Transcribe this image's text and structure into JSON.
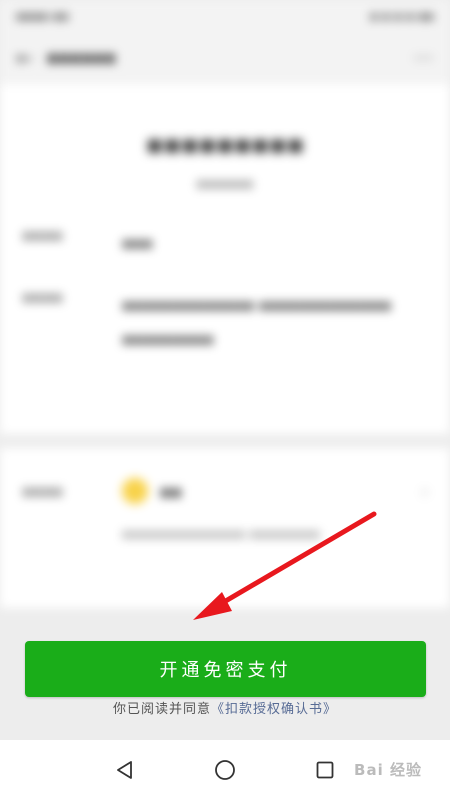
{
  "button": {
    "label": "开通免密支付",
    "color": "#1aad19"
  },
  "agreement": {
    "prefix": "你已阅读并同意",
    "link": "《扣款授权确认书》"
  },
  "system_nav": {
    "back": "back-triangle-icon",
    "home": "home-circle-icon",
    "recent": "recent-square-icon"
  },
  "annotation": {
    "arrow_color": "#e8181e"
  },
  "watermark": {
    "text": "Bai 经验"
  }
}
